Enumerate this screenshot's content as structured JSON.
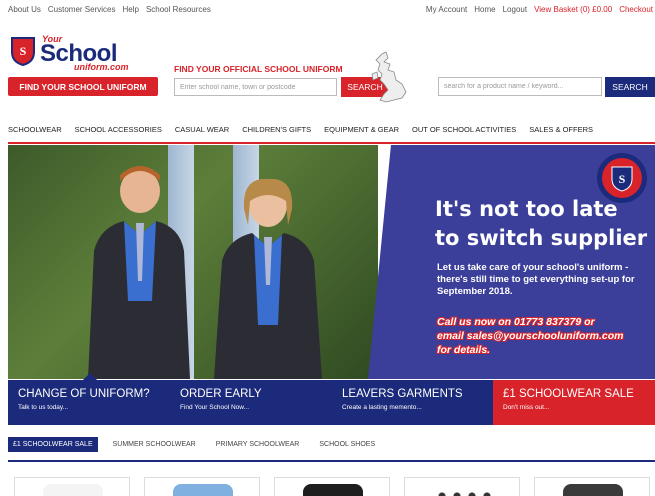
{
  "topbar": {
    "left_links": [
      "About Us",
      "Customer Services",
      "Help",
      "School Resources"
    ],
    "right_links": [
      "My Account",
      "Home",
      "Logout"
    ],
    "basket": "View Basket (0) £0.00",
    "checkout": "Checkout"
  },
  "logo": {
    "your": "Your",
    "school": "School",
    "uniform": "uniform.com"
  },
  "header": {
    "find_button": "FIND YOUR SCHOOL UNIFORM",
    "finder_title": "FIND YOUR OFFICIAL SCHOOL UNIFORM",
    "finder_placeholder": "Enter school name, town or postcode",
    "finder_button": "SEARCH",
    "product_placeholder": "search for a product name / keyword...",
    "product_button": "SEARCH"
  },
  "nav": {
    "items": [
      "SCHOOLWEAR",
      "SCHOOL ACCESSORIES",
      "CASUAL WEAR",
      "CHILDREN'S GIFTS",
      "EQUIPMENT & GEAR",
      "OUT OF SCHOOL ACTIVITIES",
      "SALES & OFFERS"
    ]
  },
  "hero": {
    "headline_1": "It's not too late",
    "headline_2": "to switch supplier",
    "sub": "Let us take care of your school's uniform - there's still time to get everything set-up for September 2018.",
    "cta_1": "Call us now on 01773 837379 or",
    "cta_2": "email sales@yourschooluniform.com",
    "cta_3": "for details."
  },
  "promos": [
    {
      "title": "CHANGE OF UNIFORM?",
      "sub": "Talk to us today..."
    },
    {
      "title": "ORDER EARLY",
      "sub": "Find Your School Now..."
    },
    {
      "title": "LEAVERS GARMENTS",
      "sub": "Create a lasting memento..."
    },
    {
      "title": "£1 SCHOOLWEAR SALE",
      "sub": "Don't miss out..."
    }
  ],
  "subtabs": [
    "£1 SCHOOLWEAR SALE",
    "SUMMER SCHOOLWEAR",
    "PRIMARY SCHOOLWEAR",
    "SCHOOL SHOES"
  ],
  "colors": {
    "brand_red": "#d8232a",
    "brand_navy": "#1b2a7a",
    "hero_blue": "#3b3f9a"
  }
}
